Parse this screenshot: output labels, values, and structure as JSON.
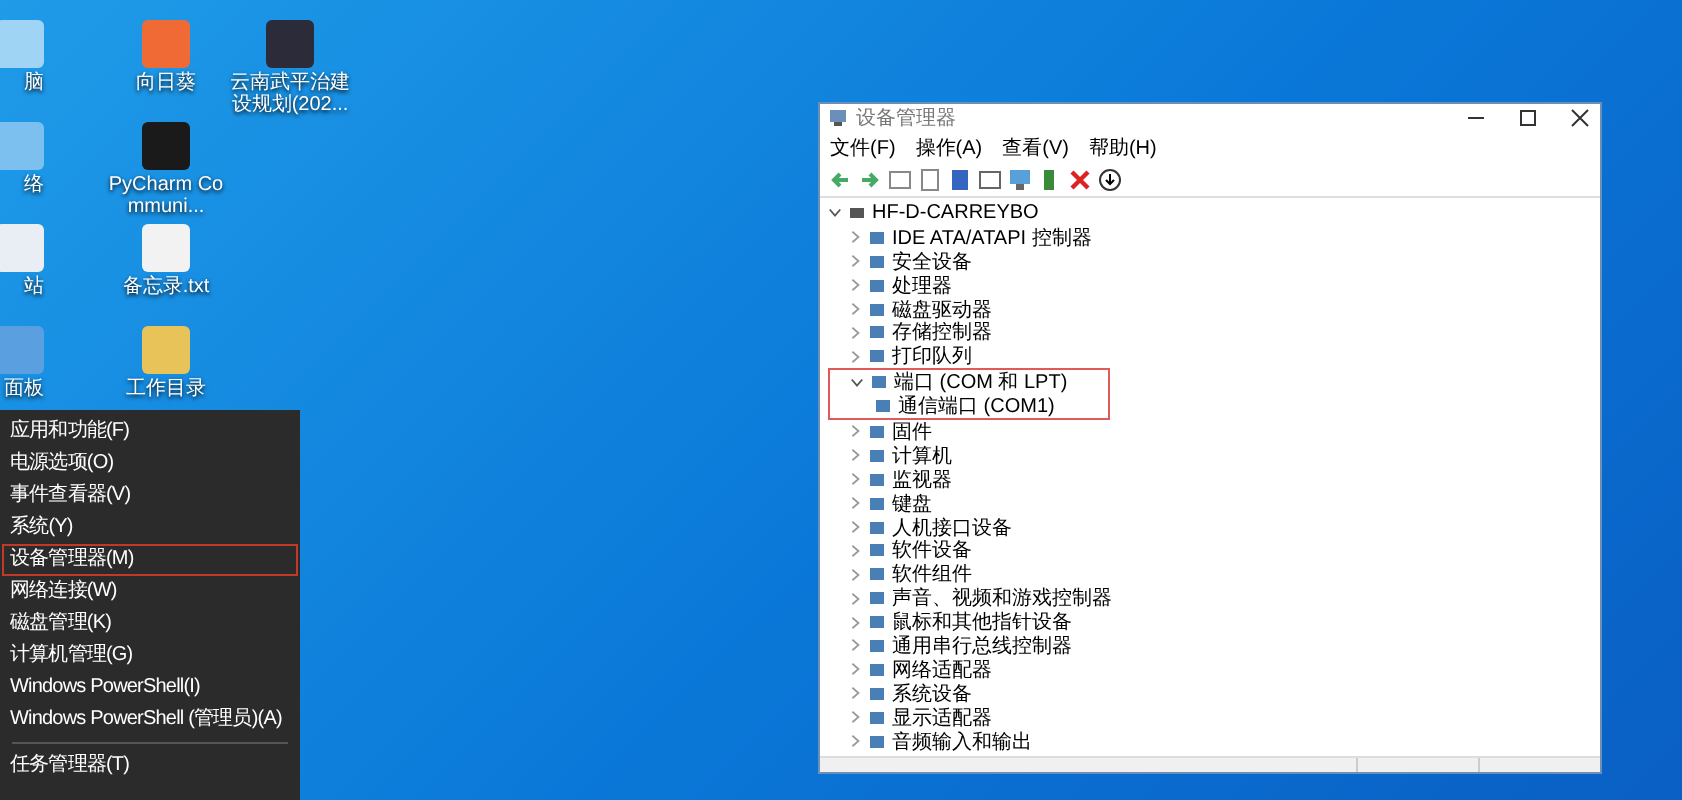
{
  "desktop_columns": [
    [
      {
        "label": "脑",
        "kind": "computer"
      },
      {
        "label": "络",
        "kind": "network"
      },
      {
        "label": "站",
        "kind": "bin"
      },
      {
        "label": "面板",
        "kind": "panel"
      }
    ],
    [
      {
        "label": "向日葵",
        "kind": "app-orange"
      },
      {
        "label": "PyCharm Communi...",
        "kind": "app-pc"
      },
      {
        "label": "备忘录.txt",
        "kind": "file"
      },
      {
        "label": "工作目录",
        "kind": "folder"
      }
    ],
    [
      {
        "label": "云南武平治建设规划(202...",
        "kind": "slides"
      }
    ]
  ],
  "context_menu": {
    "items": [
      {
        "label": "应用和功能(F)",
        "highlighted": false
      },
      {
        "label": "电源选项(O)",
        "highlighted": false
      },
      {
        "label": "事件查看器(V)",
        "highlighted": false
      },
      {
        "label": "系统(Y)",
        "highlighted": false
      },
      {
        "label": "设备管理器(M)",
        "highlighted": true
      },
      {
        "label": "网络连接(W)",
        "highlighted": false
      },
      {
        "label": "磁盘管理(K)",
        "highlighted": false
      },
      {
        "label": "计算机管理(G)",
        "highlighted": false
      },
      {
        "label": "Windows PowerShell(I)",
        "highlighted": false
      },
      {
        "label": "Windows PowerShell (管理员)(A)",
        "highlighted": false
      },
      {
        "label": "任务管理器(T)",
        "highlighted": false
      }
    ]
  },
  "window": {
    "title": "设备管理器",
    "menu": [
      "文件(F)",
      "操作(A)",
      "查看(V)",
      "帮助(H)"
    ],
    "tree": {
      "label": "HF-D-CARREYBO",
      "expanded": true,
      "children": [
        {
          "label": "IDE ATA/ATAPI 控制器",
          "expanded": false,
          "highlighted": false
        },
        {
          "label": "安全设备",
          "expanded": false,
          "highlighted": false
        },
        {
          "label": "处理器",
          "expanded": false,
          "highlighted": false
        },
        {
          "label": "磁盘驱动器",
          "expanded": false,
          "highlighted": false
        },
        {
          "label": "存储控制器",
          "expanded": false,
          "highlighted": false
        },
        {
          "label": "打印队列",
          "expanded": false,
          "highlighted": false
        },
        {
          "label": "端口 (COM 和 LPT)",
          "expanded": true,
          "highlighted": true,
          "children": [
            {
              "label": "通信端口 (COM1)"
            }
          ]
        },
        {
          "label": "固件",
          "expanded": false,
          "highlighted": false
        },
        {
          "label": "计算机",
          "expanded": false,
          "highlighted": false
        },
        {
          "label": "监视器",
          "expanded": false,
          "highlighted": false
        },
        {
          "label": "键盘",
          "expanded": false,
          "highlighted": false
        },
        {
          "label": "人机接口设备",
          "expanded": false,
          "highlighted": false
        },
        {
          "label": "软件设备",
          "expanded": false,
          "highlighted": false
        },
        {
          "label": "软件组件",
          "expanded": false,
          "highlighted": false
        },
        {
          "label": "声音、视频和游戏控制器",
          "expanded": false,
          "highlighted": false
        },
        {
          "label": "鼠标和其他指针设备",
          "expanded": false,
          "highlighted": false
        },
        {
          "label": "通用串行总线控制器",
          "expanded": false,
          "highlighted": false
        },
        {
          "label": "网络适配器",
          "expanded": false,
          "highlighted": false
        },
        {
          "label": "系统设备",
          "expanded": false,
          "highlighted": false
        },
        {
          "label": "显示适配器",
          "expanded": false,
          "highlighted": false
        },
        {
          "label": "音频输入和输出",
          "expanded": false,
          "highlighted": false
        }
      ]
    }
  }
}
